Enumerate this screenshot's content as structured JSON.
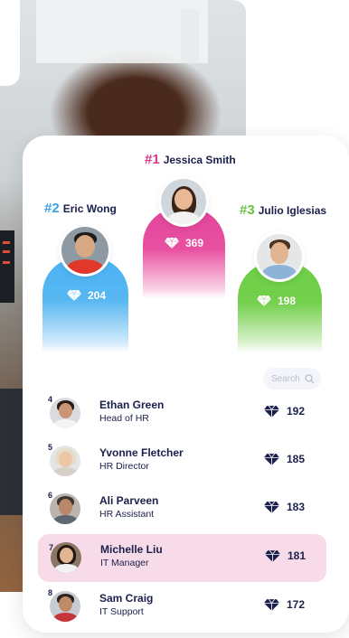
{
  "podium": [
    {
      "rank_label": "#1",
      "name": "Jessica Smith",
      "score": "369"
    },
    {
      "rank_label": "#2",
      "name": "Eric Wong",
      "score": "204"
    },
    {
      "rank_label": "#3",
      "name": "Julio Iglesias",
      "score": "198"
    }
  ],
  "search": {
    "placeholder": "Search"
  },
  "leaderboard": [
    {
      "rank": "4",
      "name": "Ethan Green",
      "title": "Head of HR",
      "score": "192"
    },
    {
      "rank": "5",
      "name": "Yvonne Fletcher",
      "title": "HR Director",
      "score": "185"
    },
    {
      "rank": "6",
      "name": "Ali Parveen",
      "title": "HR Assistant",
      "score": "183"
    },
    {
      "rank": "7",
      "name": "Michelle Liu",
      "title": "IT Manager",
      "score": "181",
      "highlighted": true
    },
    {
      "rank": "8",
      "name": "Sam Craig",
      "title": "IT Support",
      "score": "172"
    }
  ],
  "colors": {
    "first": "#d63a8a",
    "second": "#3aa0e6",
    "third": "#6ac23c",
    "highlight_row": "#f7dbe9",
    "text": "#1b1f4b"
  },
  "icons": {
    "score": "diamond-icon",
    "search": "search-icon"
  }
}
